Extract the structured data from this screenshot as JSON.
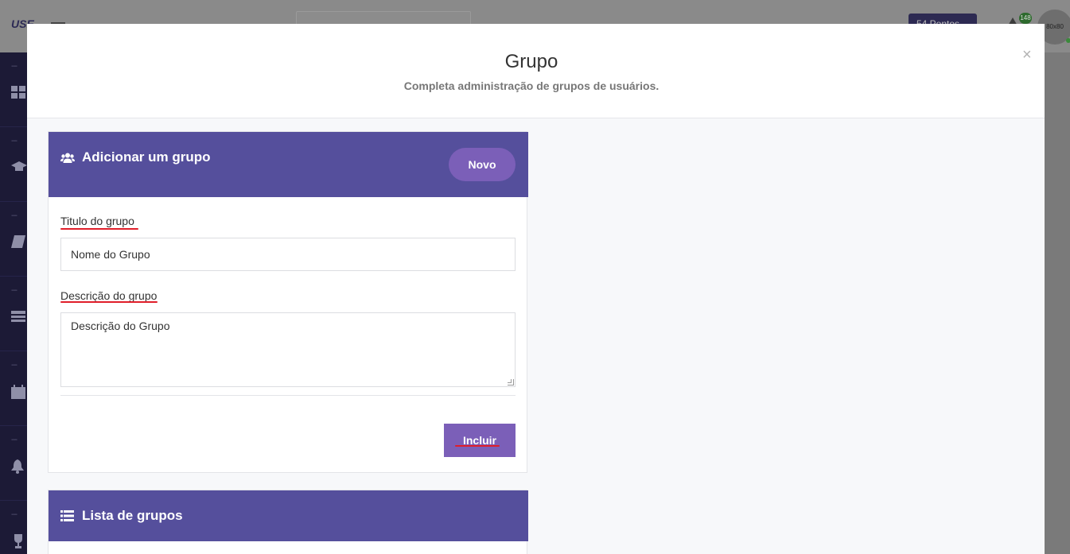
{
  "background": {
    "logo": "USE",
    "points": "54 Pontos",
    "notification_count": "148",
    "avatar_label": "80x80"
  },
  "modal": {
    "title": "Grupo",
    "subtitle": "Completa administração de grupos de usuários.",
    "close": "×"
  },
  "add_group": {
    "header": "Adicionar um grupo",
    "new_button": "Novo",
    "title_label": "Titulo do grupo",
    "title_value": "Nome do Grupo",
    "description_label": "Descrição do grupo",
    "description_value": "Descrição do Grupo",
    "submit_button": "Incluir"
  },
  "group_list": {
    "header": "Lista de grupos"
  },
  "colors": {
    "card_header": "#554f9c",
    "button": "#7b5fb8",
    "annotation_underline": "#e01e2a"
  },
  "sidebar_icons": [
    "dashboard-icon",
    "graduation-cap-icon",
    "book-icon",
    "list-icon",
    "calendar-icon",
    "bell-icon",
    "trophy-icon"
  ]
}
